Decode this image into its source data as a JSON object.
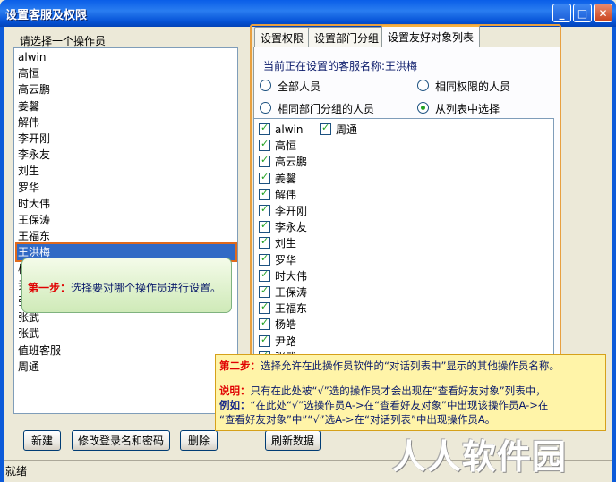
{
  "window": {
    "title": "设置客服及权限",
    "minimize": "_",
    "maximize": "□",
    "close": "✕"
  },
  "left": {
    "prompt": "请选择一个操作员",
    "operators": [
      "alwin",
      "高恒",
      "高云鹏",
      "姜馨",
      "解伟",
      "李开刚",
      "李永友",
      "刘生",
      "罗华",
      "时大伟",
      "王保涛",
      "王福东",
      "王洪梅",
      "杨皓",
      "尹路",
      "张沁",
      "张武",
      "张武",
      "值班客服",
      "周通"
    ],
    "selected_index": 12
  },
  "buttons": {
    "new": "新建",
    "edit_login": "修改登录名和密码",
    "delete": "删除",
    "refresh": "刷新数据"
  },
  "tabs": [
    "设置权限",
    "设置部门分组",
    "设置友好对象列表"
  ],
  "active_tab": 2,
  "panel": {
    "current_label": "当前正在设置的客服名称:王洪梅",
    "radios": [
      {
        "label": "全部人员",
        "checked": false
      },
      {
        "label": "相同权限的人员",
        "checked": false
      },
      {
        "label": "相同部门分组的人员",
        "checked": false
      },
      {
        "label": "从列表中选择",
        "checked": true
      }
    ],
    "checked_items_col1": [
      "alwin",
      "高恒",
      "高云鹏",
      "姜馨",
      "解伟",
      "李开刚",
      "李永友",
      "刘生",
      "罗华",
      "时大伟",
      "王保涛",
      "王福东",
      "杨皓",
      "尹路",
      "张武"
    ],
    "checked_items_col2": [
      "周通"
    ]
  },
  "notes": {
    "step1_label": "第一步：",
    "step1_text": "选择要对哪个操作员进行设置。",
    "step2_label": "第二步：",
    "step2_text": "选择允许在此操作员软件的“对话列表中”显示的其他操作员名称。",
    "explain_label": "说明：",
    "explain_text": "只有在此处被“√”选的操作员才会出现在“查看好友对象”列表中，",
    "example_label": "例如：",
    "example_line1": "“在此处“√”选操作员A->在“查看好友对象”中出现该操作员A->在",
    "example_line2": "“查看好友对象”中”“√”选A->在“对话列表”中出现操作员A。"
  },
  "status": "就绪",
  "watermark": "人人软件园"
}
